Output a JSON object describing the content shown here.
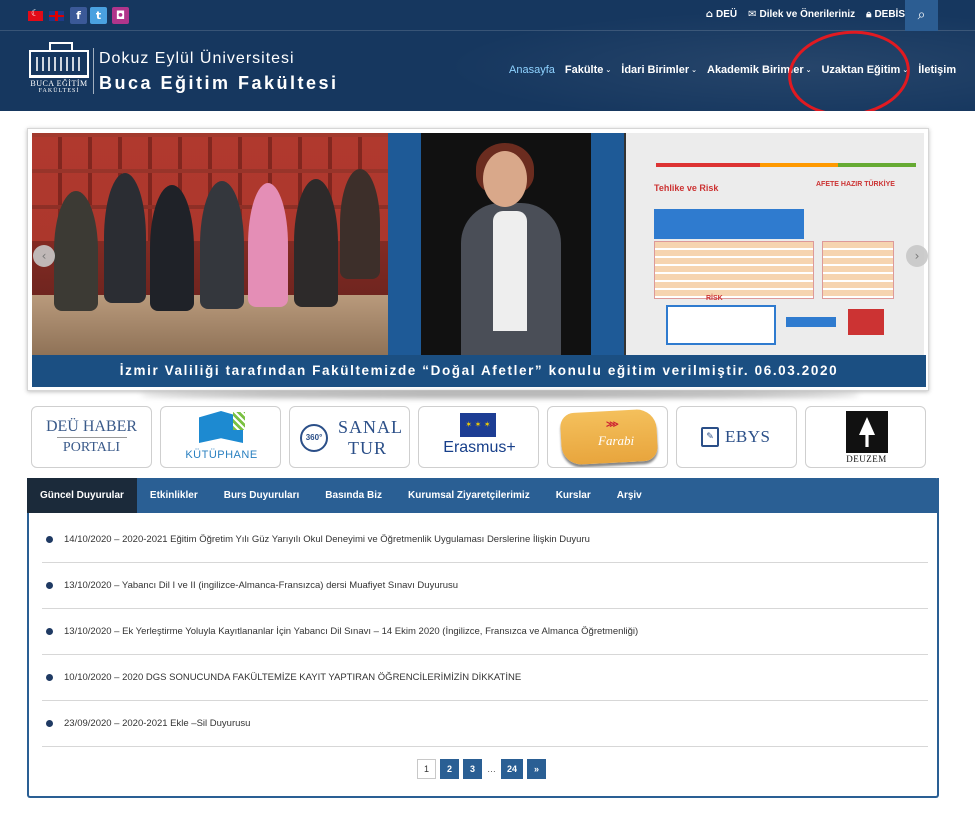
{
  "header": {
    "top_links": [
      {
        "icon": "home-icon",
        "label": "DEÜ"
      },
      {
        "icon": "envelope-icon",
        "label": "Dilek ve Önerileriniz"
      },
      {
        "icon": "lock-icon",
        "label": "DEBİS"
      }
    ],
    "brand": {
      "logo_line1": "BUCA EĞİTİM",
      "logo_line2": "FAKÜLTESİ",
      "university": "Dokuz Eylül Üniversitesi",
      "faculty": "Buca Eğitim Fakültesi"
    },
    "nav": [
      {
        "label": "Anasayfa",
        "active": true,
        "dropdown": false
      },
      {
        "label": "Fakülte",
        "dropdown": true
      },
      {
        "label": "İdari Birimler",
        "dropdown": true
      },
      {
        "label": "Akademik Birimler",
        "dropdown": true
      },
      {
        "label": "Uzaktan Eğitim",
        "dropdown": true
      },
      {
        "label": "İletişim",
        "dropdown": false
      }
    ],
    "icons": {
      "caret": "⌄",
      "search": "⌕"
    }
  },
  "slider": {
    "caption": "İzmir Valiliği tarafından Fakültemizde “Doğal Afetler” konulu eğitim verilmiştir. 06.03.2020",
    "slide_text": {
      "title": "Tehlike ve Risk",
      "badge": "AFETE HAZIR TÜRKİYE",
      "risk": "RİSK"
    }
  },
  "quick_links": {
    "haber_line1": "DEÜ HABER",
    "haber_line2": "PORTALI",
    "kutuphane": "KÜTÜPHANE",
    "sanal_360": "360°",
    "sanal_line1": "SANAL",
    "sanal_line2": "TUR",
    "erasmus": "Erasmus+",
    "farabi": "Farabi",
    "ebys": "EBYS",
    "deuzem": "DEUZEM"
  },
  "announcements": {
    "tabs": [
      "Güncel Duyurular",
      "Etkinlikler",
      "Burs Duyuruları",
      "Basında Biz",
      "Kurumsal Ziyaretçilerimiz",
      "Kurslar",
      "Arşiv"
    ],
    "active_tab": 0,
    "items": [
      "14/10/2020 – 2020-2021 Eğitim Öğretim Yılı Güz Yarıyılı Okul Deneyimi ve Öğretmenlik Uygulaması Derslerine İlişkin Duyuru",
      "13/10/2020 – Yabancı Dil I ve II (ingilizce-Almanca-Fransızca) dersi Muafiyet Sınavı Duyurusu",
      "13/10/2020 – Ek Yerleştirme Yoluyla Kayıtlananlar İçin Yabancı Dil Sınavı – 14 Ekim 2020 (İngilizce, Fransızca ve Almanca Öğretmenliği)",
      "10/10/2020 – 2020 DGS SONUCUNDA FAKÜLTEMİZE KAYIT YAPTIRAN ÖĞRENCİLERİMİZİN DİKKATİNE",
      "23/09/2020 – 2020-2021 Ekle –Sil Duyurusu"
    ],
    "pagination": {
      "pages": [
        "1",
        "2",
        "3"
      ],
      "ellipsis": "…",
      "last": "24",
      "next": "»",
      "current": "1"
    }
  },
  "colors": {
    "header_bg": "#16375f",
    "accent": "#2a5f94",
    "active_nav": "#8ed2ff",
    "annotation": "#e11a21"
  }
}
